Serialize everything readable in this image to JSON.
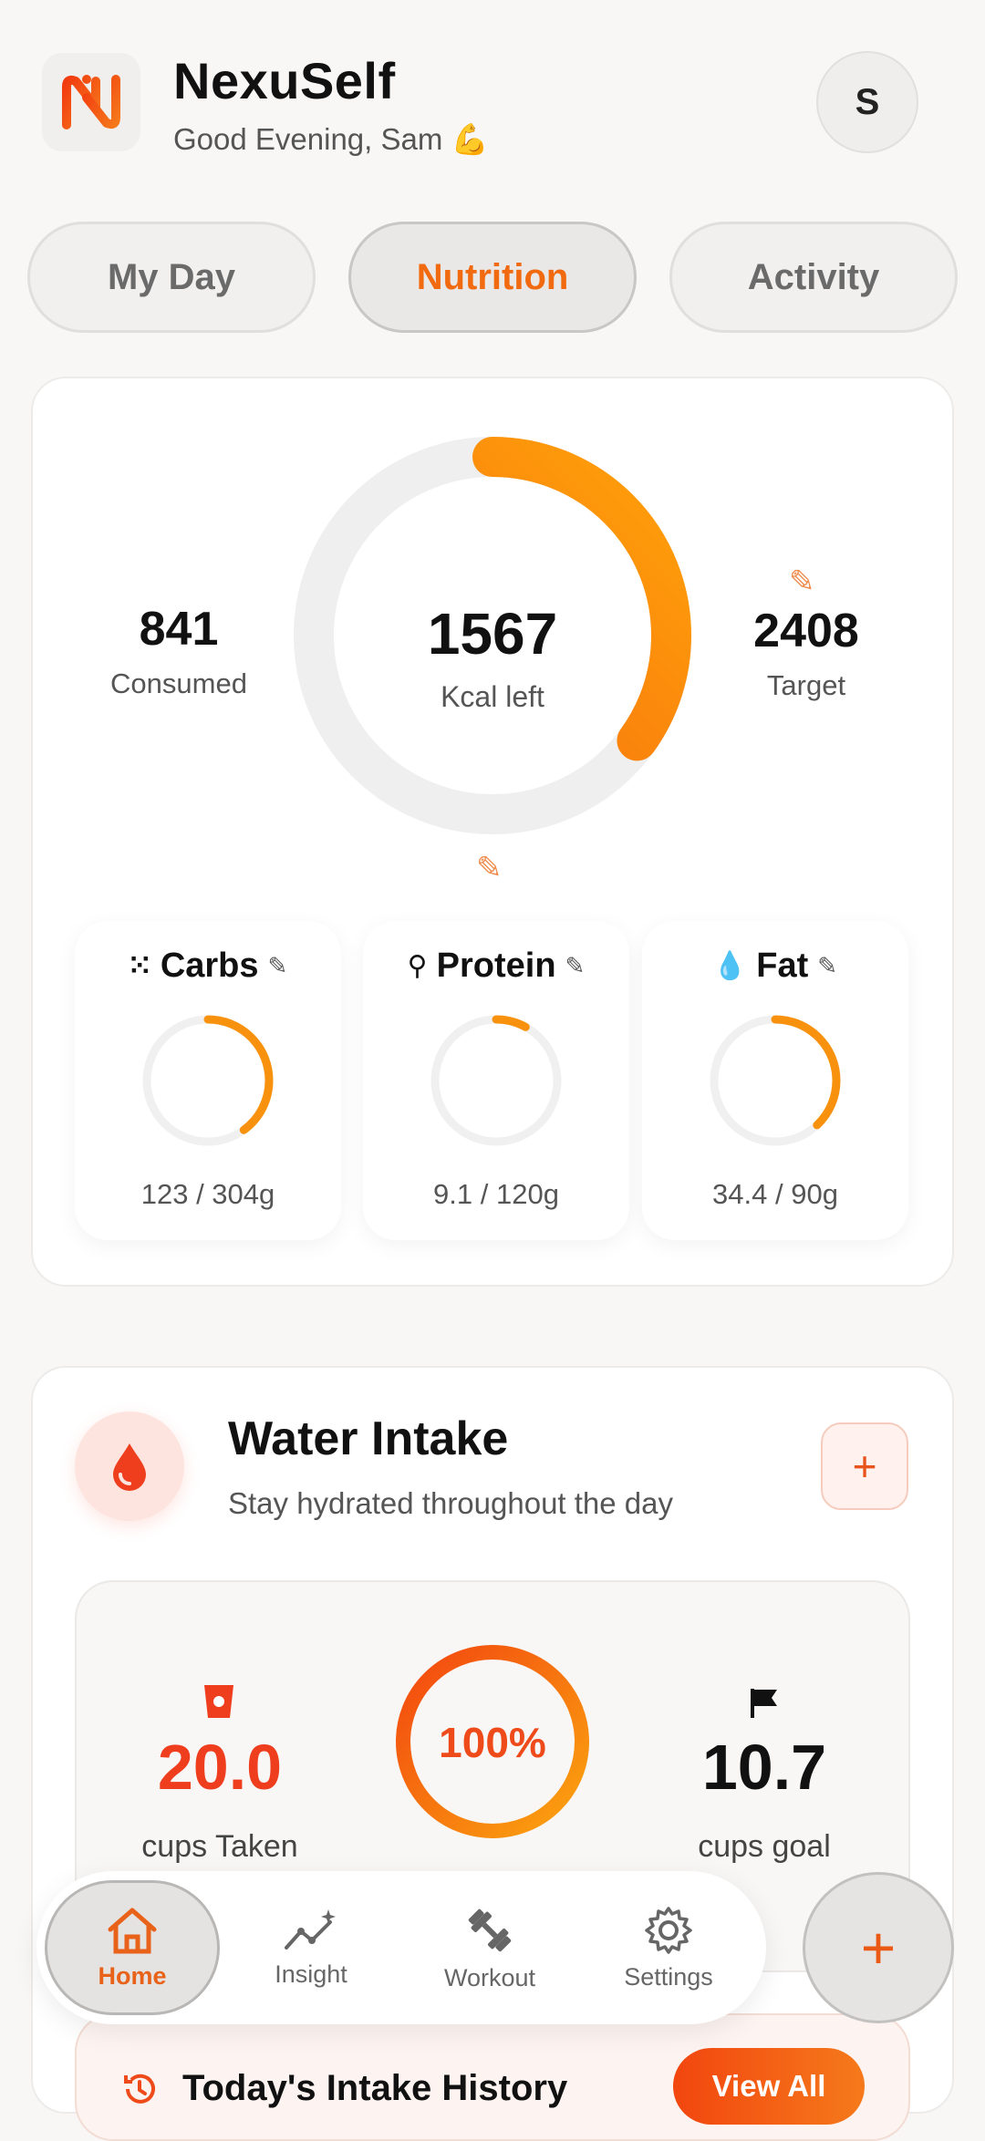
{
  "header": {
    "app_title": "NexuSelf",
    "greeting": "Good Evening, Sam 💪",
    "avatar_initial": "S"
  },
  "tabs": [
    {
      "label": "My Day",
      "active": false
    },
    {
      "label": "Nutrition",
      "active": true
    },
    {
      "label": "Activity",
      "active": false
    }
  ],
  "calories": {
    "consumed_value": "841",
    "consumed_label": "Consumed",
    "left_value": "1567",
    "left_label": "Kcal left",
    "target_value": "2408",
    "target_label": "Target",
    "ring_progress": 0.35
  },
  "macros": [
    {
      "name": "Carbs",
      "icon": "grain-icon",
      "value": "123 / 304g",
      "progress": 0.4
    },
    {
      "name": "Protein",
      "icon": "protein-icon",
      "value": "9.1 / 120g",
      "progress": 0.08
    },
    {
      "name": "Fat",
      "icon": "droplet-icon",
      "value": "34.4 / 90g",
      "progress": 0.38
    }
  ],
  "water": {
    "title": "Water Intake",
    "subtitle": "Stay hydrated throughout the day",
    "add_label": "+",
    "taken_value": "20.0",
    "taken_label": "cups Taken",
    "percent": "100%",
    "progress": 1.0,
    "goal_value": "10.7",
    "goal_label": "cups goal"
  },
  "history": {
    "title": "Today's Intake History",
    "view_all": "View All"
  },
  "nav": [
    {
      "label": "Home",
      "icon": "home-icon",
      "active": true
    },
    {
      "label": "Insight",
      "icon": "insight-icon",
      "active": false
    },
    {
      "label": "Workout",
      "icon": "dumbbell-icon",
      "active": false
    },
    {
      "label": "Settings",
      "icon": "gear-icon",
      "active": false
    }
  ],
  "fab_label": "+",
  "colors": {
    "accent": "#f26a0f",
    "accent_dark": "#e8521b",
    "ring_track": "#efefef",
    "background": "#f8f7f6"
  }
}
